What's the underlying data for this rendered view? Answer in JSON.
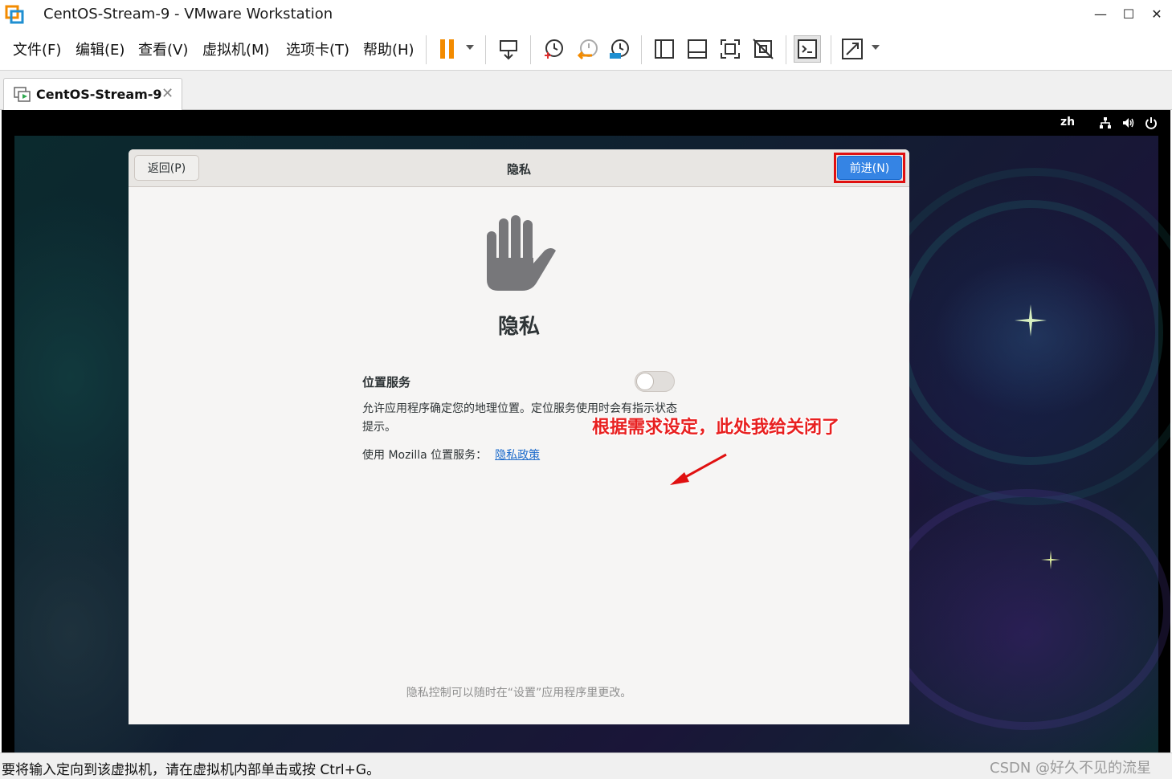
{
  "window": {
    "title": "CentOS-Stream-9 - VMware Workstation",
    "minimize": "—",
    "maximize": "☐",
    "close": "✕"
  },
  "menu": {
    "items": [
      "文件(F)",
      "编辑(E)",
      "查看(V)",
      "虚拟机(M)",
      "选项卡(T)",
      "帮助(H)"
    ]
  },
  "toolbar": {
    "icons": [
      "pause-icon",
      "send-ctrl-alt-del-icon",
      "snapshot-icon",
      "revert-snapshot-icon",
      "snapshot-manager-icon",
      "sidebar-icon",
      "thumbnail-bar-icon",
      "fullscreen-icon",
      "unity-icon",
      "console-icon",
      "stretch-icon"
    ]
  },
  "tab": {
    "label": "CentOS-Stream-9",
    "close": "✕"
  },
  "vm_topbar": {
    "lang": "zh"
  },
  "dialog": {
    "back_label": "返回(P)",
    "title": "隐私",
    "next_label": "前进(N)",
    "heading": "隐私",
    "location_label": "位置服务",
    "location_enabled": false,
    "description": "允许应用程序确定您的地理位置。定位服务使用时会有指示状态提示。",
    "mozilla_text": "使用 Mozilla 位置服务：",
    "policy_link": "隐私政策",
    "footnote": "隐私控制可以随时在“设置”应用程序里更改。"
  },
  "annotation": {
    "text": "根据需求设定，此处我给关闭了"
  },
  "status": {
    "text": "要将输入定向到该虚拟机，请在虚拟机内部单击或按 Ctrl+G。",
    "watermark": "CSDN @好久不见的流星"
  },
  "colors": {
    "accent": "#3584e4",
    "highlight": "#e01010",
    "vmware_orange": "#f38b00"
  }
}
